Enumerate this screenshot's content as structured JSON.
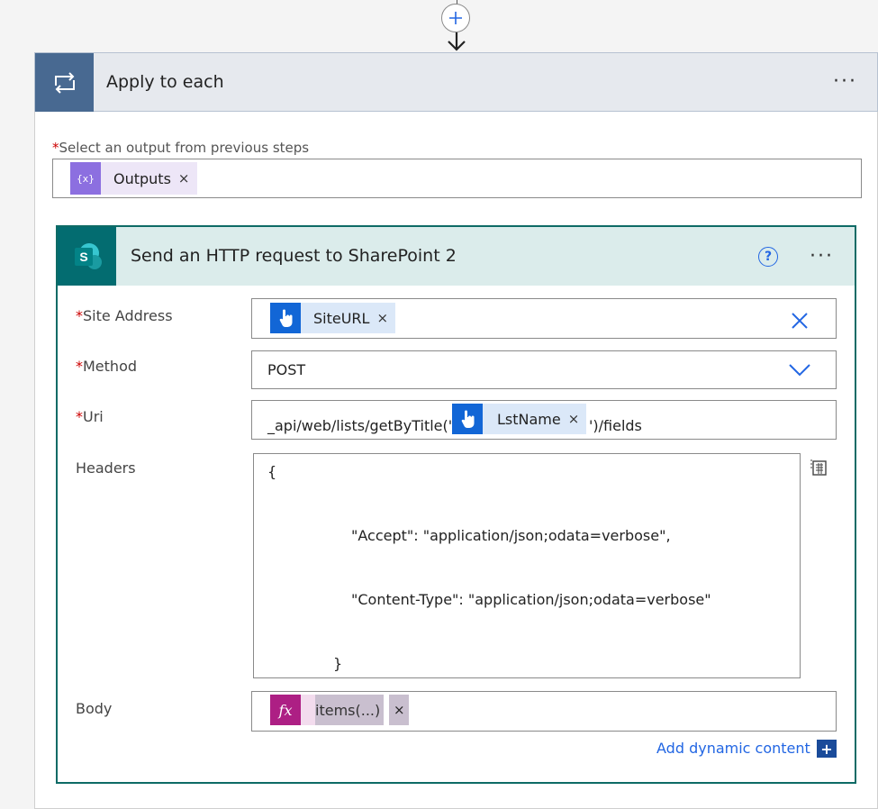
{
  "connector": {
    "add_step_icon": "plus-circle-icon",
    "arrow_icon": "arrow-down-icon"
  },
  "apply_to_each": {
    "title": "Apply to each",
    "icon": "loop-icon",
    "more": "···",
    "required_marker": "*",
    "select_label": "Select an output from previous steps",
    "token": {
      "icon": "variable-icon",
      "icon_text": "{x}",
      "label": "Outputs",
      "remove": "×"
    }
  },
  "sharepoint_action": {
    "title": "Send an HTTP request to SharePoint 2",
    "icon": "sharepoint-icon",
    "icon_text": "S",
    "help": "?",
    "more": "···",
    "fields": {
      "site_address": {
        "label": "Site Address",
        "required": "*",
        "token_label": "SiteURL",
        "token_remove": "×",
        "clear_icon": "close-icon"
      },
      "method": {
        "label": "Method",
        "required": "*",
        "value": "POST",
        "dropdown_icon": "chevron-down-icon"
      },
      "uri": {
        "label": "Uri",
        "required": "*",
        "prefix": "_api/web/lists/getByTitle('",
        "token_label": "LstName",
        "token_remove": "×",
        "suffix": "')/fields"
      },
      "headers": {
        "label": "Headers",
        "lines": [
          "{",
          "\"Accept\": \"application/json;odata=verbose\",",
          "\"Content-Type\": \"application/json;odata=verbose\"",
          "}"
        ],
        "mode_icon": "text-mode-icon"
      },
      "body": {
        "label": "Body",
        "expr_icon_text": "fx",
        "expr_label": "items(...)",
        "expr_remove": "×"
      }
    },
    "add_dynamic_content": "Add dynamic content",
    "add_dynamic_icon": "+"
  },
  "colors": {
    "apply_header_icon_bg": "#486991",
    "sharepoint_teal": "#036c70",
    "dynamic_blue": "#1266d6",
    "expression_magenta": "#ad1f84",
    "variable_purple": "#8c6fe0",
    "link_blue": "#2266e3"
  }
}
